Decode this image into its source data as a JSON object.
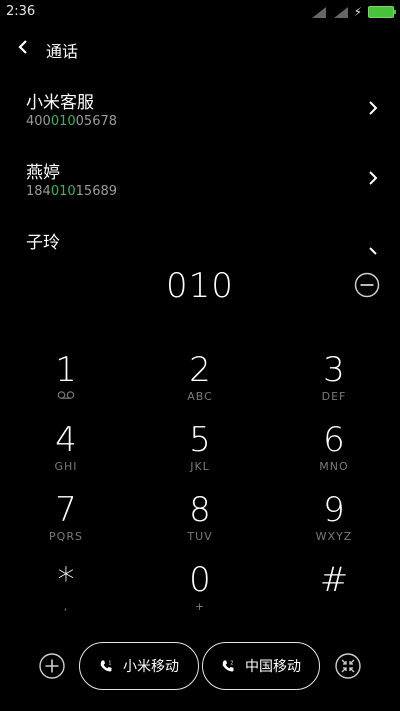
{
  "status_bar": {
    "time": "2:36"
  },
  "header": {
    "title": "通话"
  },
  "contacts": [
    {
      "name": "小米客服",
      "number_pre": "400",
      "number_hl": "010",
      "number_post": "05678"
    },
    {
      "name": "燕婷",
      "number_pre": "184",
      "number_hl": "010",
      "number_post": "15689"
    },
    {
      "name": "子玲",
      "number_pre": "",
      "number_hl": "",
      "number_post": ""
    }
  ],
  "dial": {
    "input": "010"
  },
  "keypad": [
    {
      "digit": "1",
      "letters": ""
    },
    {
      "digit": "2",
      "letters": "ABC"
    },
    {
      "digit": "3",
      "letters": "DEF"
    },
    {
      "digit": "4",
      "letters": "GHI"
    },
    {
      "digit": "5",
      "letters": "JKL"
    },
    {
      "digit": "6",
      "letters": "MNO"
    },
    {
      "digit": "7",
      "letters": "PQRS"
    },
    {
      "digit": "8",
      "letters": "TUV"
    },
    {
      "digit": "9",
      "letters": "WXYZ"
    },
    {
      "digit": "*",
      "letters": ","
    },
    {
      "digit": "0",
      "letters": "+"
    },
    {
      "digit": "#",
      "letters": ""
    }
  ],
  "bottom": {
    "sim1_label": "小米移动",
    "sim2_label": "中国移动"
  },
  "colors": {
    "background": "#000000",
    "match_highlight": "#33b75a",
    "battery": "#47c23a"
  }
}
